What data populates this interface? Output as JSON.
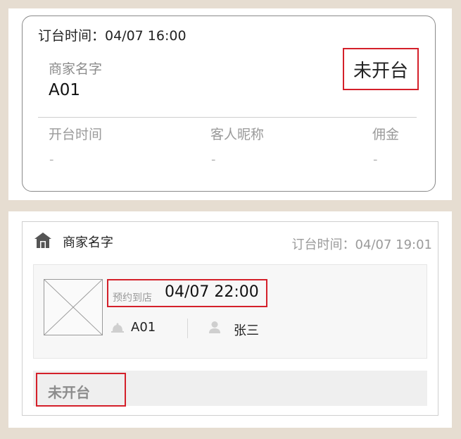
{
  "card1": {
    "order_time": "订台时间：04/07 16:00",
    "merchant_label": "商家名字",
    "merchant_value": "A01",
    "status": "未开台",
    "columns": [
      {
        "label": "开台时间",
        "value": "-"
      },
      {
        "label": "客人昵称",
        "value": "-"
      },
      {
        "label": "佣金",
        "value": "-"
      }
    ]
  },
  "card2": {
    "store_icon": "store-icon",
    "merchant_name": "商家名字",
    "order_time": "订台时间：04/07 19:01",
    "arrive_label": "预约到店",
    "arrive_time": "04/07 22:00",
    "table_icon": "bell-icon",
    "table": "A01",
    "guest_icon": "person-icon",
    "guest": "张三",
    "status": "未开台"
  },
  "colors": {
    "background": "#e6ddd1",
    "highlight": "#d4202a",
    "muted_text": "#9a9a9a"
  }
}
